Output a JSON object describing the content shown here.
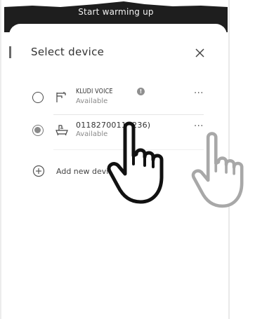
{
  "top_band": {
    "label": "Start warming up"
  },
  "dialog": {
    "title": "Select device",
    "close_icon": "close-icon"
  },
  "devices": [
    {
      "name": "KLUDI VOICE",
      "status": "Available",
      "selected": false,
      "icon": "faucet-icon",
      "has_info_badge": true,
      "info_badge": "!",
      "more": "···"
    },
    {
      "name": "0118270011 (236)",
      "status": "Available",
      "selected": true,
      "icon": "bathtub-icon",
      "has_info_badge": false,
      "more": "···"
    }
  ],
  "add_device": {
    "label": "Add new device",
    "icon": "plus-circle-icon"
  },
  "colors": {
    "top_band": "#1e1e1e",
    "accent_grey": "#8a8a8a",
    "text": "#333333",
    "divider": "#e6e6e6"
  },
  "overlays": {
    "tap_hand": "tap-hand-icon",
    "ghost_hand": "ghost-hand-icon"
  }
}
